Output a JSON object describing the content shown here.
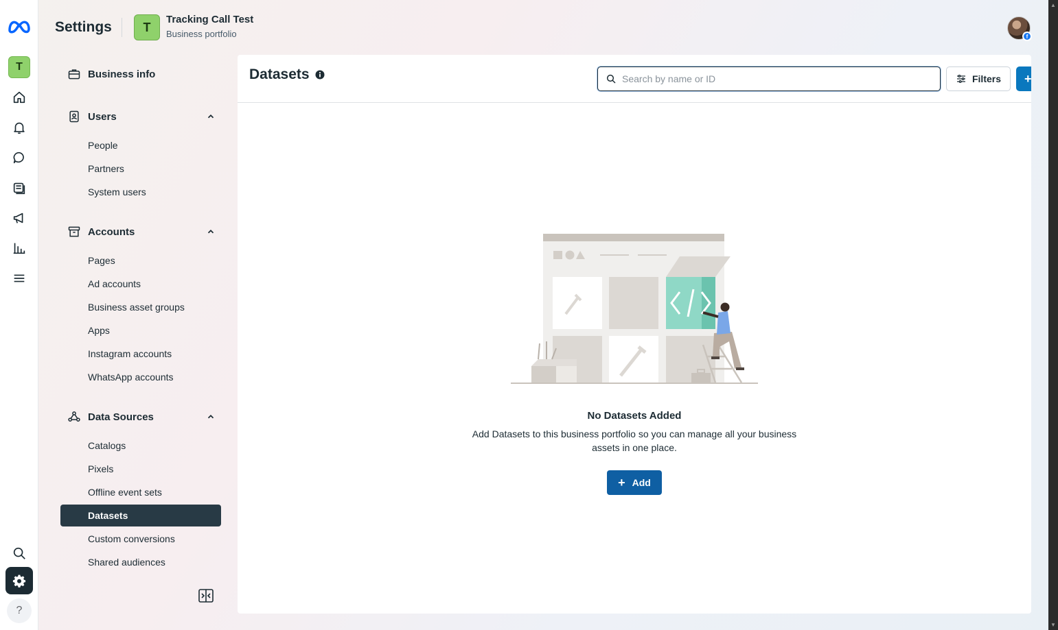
{
  "rail": {
    "workspace_initial": "T",
    "icons": [
      "meta-logo-icon",
      "home-icon",
      "bell-icon",
      "chat-icon",
      "pages-icon",
      "megaphone-icon",
      "insights-icon",
      "menu-icon",
      "search-icon",
      "settings-icon",
      "help-icon"
    ],
    "help_glyph": "?"
  },
  "header": {
    "title": "Settings",
    "business_initial": "T",
    "business_name": "Tracking Call Test",
    "business_subtitle": "Business portfolio"
  },
  "sidebar": {
    "business_info": "Business info",
    "sections": [
      {
        "label": "Users",
        "items": [
          "People",
          "Partners",
          "System users"
        ]
      },
      {
        "label": "Accounts",
        "items": [
          "Pages",
          "Ad accounts",
          "Business asset groups",
          "Apps",
          "Instagram accounts",
          "WhatsApp accounts"
        ]
      },
      {
        "label": "Data Sources",
        "items": [
          "Catalogs",
          "Pixels",
          "Offline event sets",
          "Datasets",
          "Custom conversions",
          "Shared audiences"
        ]
      }
    ],
    "active_item": "Datasets"
  },
  "main": {
    "title": "Datasets",
    "search_placeholder": "Search by name or ID",
    "filters_label": "Filters",
    "add_glyph": "+",
    "empty_title": "No Datasets Added",
    "empty_description": "Add Datasets to this business portfolio so you can manage all your business assets in one place.",
    "add_button_label": "Add"
  },
  "colors": {
    "active_nav_bg": "#283a45",
    "primary_button": "#0f5fa3",
    "accent_green": "#8fd16b"
  }
}
